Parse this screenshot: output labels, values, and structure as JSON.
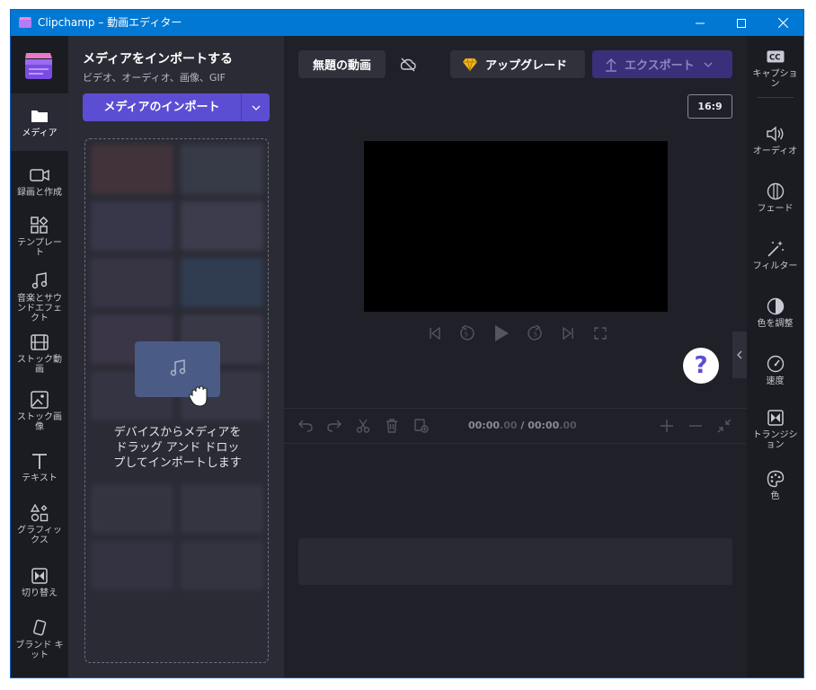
{
  "window": {
    "title": "Clipchamp – 動画エディター"
  },
  "left_rail": {
    "items": [
      {
        "label": "メディア",
        "icon": "folder-icon",
        "active": true
      },
      {
        "label": "録画と作成",
        "icon": "camera-icon"
      },
      {
        "label": "テンプレー\nト",
        "icon": "templates-icon"
      },
      {
        "label": "音楽とサウ\nンドエフェ\nクト",
        "icon": "music-note-icon"
      },
      {
        "label": "ストック動\n画",
        "icon": "film-icon"
      },
      {
        "label": "ストック画\n像",
        "icon": "image-icon"
      },
      {
        "label": "テキスト",
        "icon": "text-icon"
      },
      {
        "label": "グラフィッ\nクス",
        "icon": "shapes-icon"
      },
      {
        "label": "切り替え",
        "icon": "transition-icon"
      },
      {
        "label": "ブランド キ\nット",
        "icon": "brand-kit-icon"
      }
    ]
  },
  "media_panel": {
    "heading": "メディアをインポートする",
    "subheading": "ビデオ、オーディオ、画像、GIF",
    "import_button": "メディアのインポート",
    "drop_text": "デバイスからメディアを\nドラッグ アンド ドロッ\nプしてインポートします"
  },
  "editor": {
    "video_title": "無題の動画",
    "upgrade_label": "アップグレード",
    "export_label": "エクスポート",
    "aspect_ratio": "16:9",
    "help_label": "?",
    "timecode_current": "00:00",
    "timecode_current_frac": ".00",
    "timecode_sep": " / ",
    "timecode_total": "00:00",
    "timecode_total_frac": ".00"
  },
  "right_rail": {
    "items": [
      {
        "label": "キャプショ\nン",
        "icon": "cc-icon"
      },
      {
        "label": "オーディオ",
        "icon": "speaker-icon"
      },
      {
        "label": "フェード",
        "icon": "fade-icon"
      },
      {
        "label": "フィルター",
        "icon": "magic-wand-icon"
      },
      {
        "label": "色を調整",
        "icon": "contrast-icon"
      },
      {
        "label": "速度",
        "icon": "speedometer-icon"
      },
      {
        "label": "トランジシ\nョン",
        "icon": "transition-icon"
      },
      {
        "label": "色",
        "icon": "palette-icon"
      }
    ]
  },
  "colors": {
    "accent": "#5b4ed3",
    "titlebar": "#0078d4",
    "upgrade_gem": "#f2b51b"
  }
}
